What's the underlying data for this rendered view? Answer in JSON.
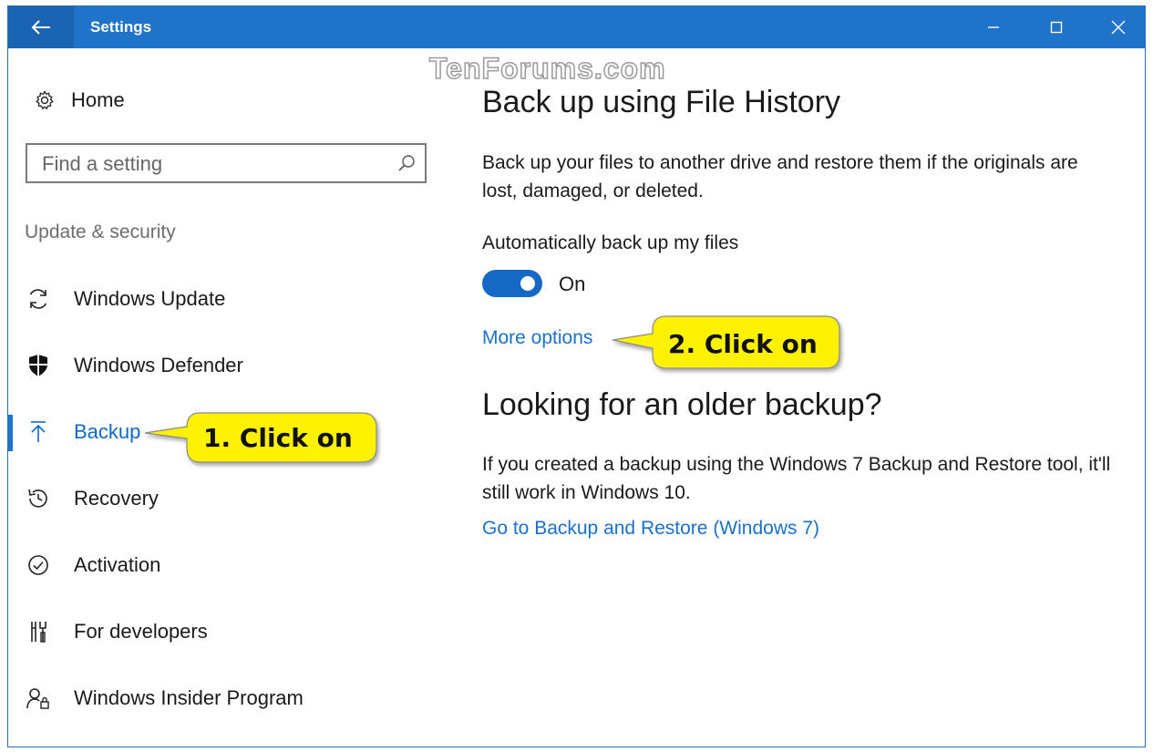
{
  "window": {
    "title": "Settings",
    "controls": [
      "minimize-icon",
      "maximize-icon",
      "close-icon"
    ],
    "accent_color": "#1f73c9"
  },
  "watermark": "TenForums.com",
  "sidebar": {
    "home_label": "Home",
    "search_placeholder": "Find a setting",
    "section_label": "Update & security",
    "items": [
      {
        "label": "Windows Update",
        "icon": "sync-icon",
        "selected": false
      },
      {
        "label": "Windows Defender",
        "icon": "shield-icon",
        "selected": false
      },
      {
        "label": "Backup",
        "icon": "upload-arrow-icon",
        "selected": true
      },
      {
        "label": "Recovery",
        "icon": "history-icon",
        "selected": false
      },
      {
        "label": "Activation",
        "icon": "check-circle-icon",
        "selected": false
      },
      {
        "label": "For developers",
        "icon": "developer-tools-icon",
        "selected": false
      },
      {
        "label": "Windows Insider Program",
        "icon": "insider-person-icon",
        "selected": false
      }
    ]
  },
  "main": {
    "file_history": {
      "heading": "Back up using File History",
      "description": "Back up your files to another drive and restore them if the originals are lost, damaged, or deleted.",
      "auto_backup_label": "Automatically back up my files",
      "toggle_state": "On",
      "toggle_on": true,
      "more_options_link": "More options"
    },
    "older_backup": {
      "heading": "Looking for an older backup?",
      "description": "If you created a backup using the Windows 7 Backup and Restore tool, it'll still work in Windows 10.",
      "restore_link": "Go to Backup and Restore (Windows 7)"
    }
  },
  "callouts": [
    {
      "text": "1. Click on",
      "color": "#fff200"
    },
    {
      "text": "2. Click on",
      "color": "#fff200"
    }
  ]
}
